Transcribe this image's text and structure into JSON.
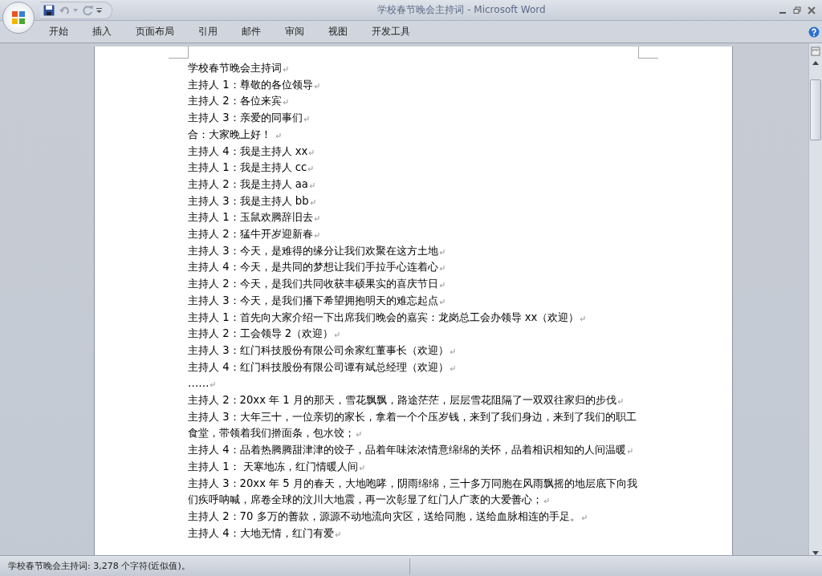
{
  "window": {
    "title": "学校春节晚会主持词 - Microsoft Word"
  },
  "tabs": [
    {
      "label": "开始",
      "selected": false
    },
    {
      "label": "插入",
      "selected": false
    },
    {
      "label": "页面布局",
      "selected": false
    },
    {
      "label": "引用",
      "selected": false
    },
    {
      "label": "邮件",
      "selected": false
    },
    {
      "label": "审阅",
      "selected": false
    },
    {
      "label": "视图",
      "selected": false
    },
    {
      "label": "开发工具",
      "selected": false
    }
  ],
  "document": {
    "formatting_marks": true,
    "paragraphs": [
      "学校春节晚会主持词",
      "主持人 1：尊敬的各位领导",
      "主持人 2：各位来宾",
      "主持人 3：亲爱的同事们",
      "合：大家晚上好！ ",
      "主持人 4：我是主持人 xx",
      "主持人 1：我是主持人 cc",
      "主持人 2：我是主持人 aa",
      "主持人 3：我是主持人 bb",
      "主持人 1：玉鼠欢腾辞旧去",
      "主持人 2：猛牛开岁迎新春",
      "主持人 3：今天，是难得的缘分让我们欢聚在这方土地",
      "主持人 4：今天，是共同的梦想让我们手拉手心连着心",
      "主持人 2：今天，是我们共同收获丰硕果实的喜庆节日",
      "主持人 3：今天，是我们播下希望拥抱明天的难忘起点",
      "主持人 1：首先向大家介绍一下出席我们晚会的嘉宾：龙岗总工会办领导 xx（欢迎）",
      "主持人 2：工会领导 2（欢迎）",
      "主持人 3：红门科技股份有限公司余家红董事长（欢迎）",
      "主持人 4：红门科技股份有限公司谭有斌总经理（欢迎）",
      "……",
      "主持人 2：20xx 年 1 月的那天，雪花飘飘，路途茫茫，层层雪花阻隔了一双双往家归的步伐",
      "主持人 3：大年三十，一位亲切的家长，拿着一个个压岁钱，来到了我们身边，来到了我们的职工食堂，带领着我们擀面条，包水饺；",
      "主持人 4：品着热腾腾甜津津的饺子，品着年味浓浓情意绵绵的关怀，品着相识相知的人间温暖",
      "主持人 1： 天寒地冻，红门情暖人间",
      "主持人 3：20xx 年 5 月的春天，大地咆哮，阴雨绵绵，三十多万同胞在风雨飘摇的地层底下向我们疾呼呐喊，席卷全球的汶川大地震，再一次彰显了红门人广袤的大爱善心；",
      "主持人 2：70 多万的善款，源源不动地流向灾区，送给同胞，送给血脉相连的手足。",
      "主持人 4：大地无情，红门有爱"
    ]
  },
  "status_bar": {
    "text": "学校春节晚会主持词: 3,278 个字符(近似值)。"
  }
}
